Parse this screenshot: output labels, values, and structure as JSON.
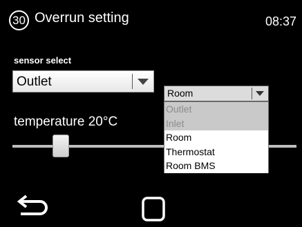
{
  "header": {
    "step_number": "30",
    "title": "Overrun setting",
    "time": "08:37"
  },
  "sensor": {
    "label": "sensor select",
    "selected": "Outlet"
  },
  "temperature": {
    "label": "temperature 20°C",
    "slider_fraction": 0.17
  },
  "dropdown": {
    "selected": "Room",
    "options": [
      {
        "label": "Outlet",
        "enabled": false
      },
      {
        "label": "Inlet",
        "enabled": false
      },
      {
        "label": "Room",
        "enabled": true
      },
      {
        "label": "Thermostat",
        "enabled": true
      },
      {
        "label": "Room BMS",
        "enabled": true
      }
    ]
  },
  "nav": {
    "back_icon": "back-arrow-icon",
    "home_icon": "home-square-icon"
  }
}
